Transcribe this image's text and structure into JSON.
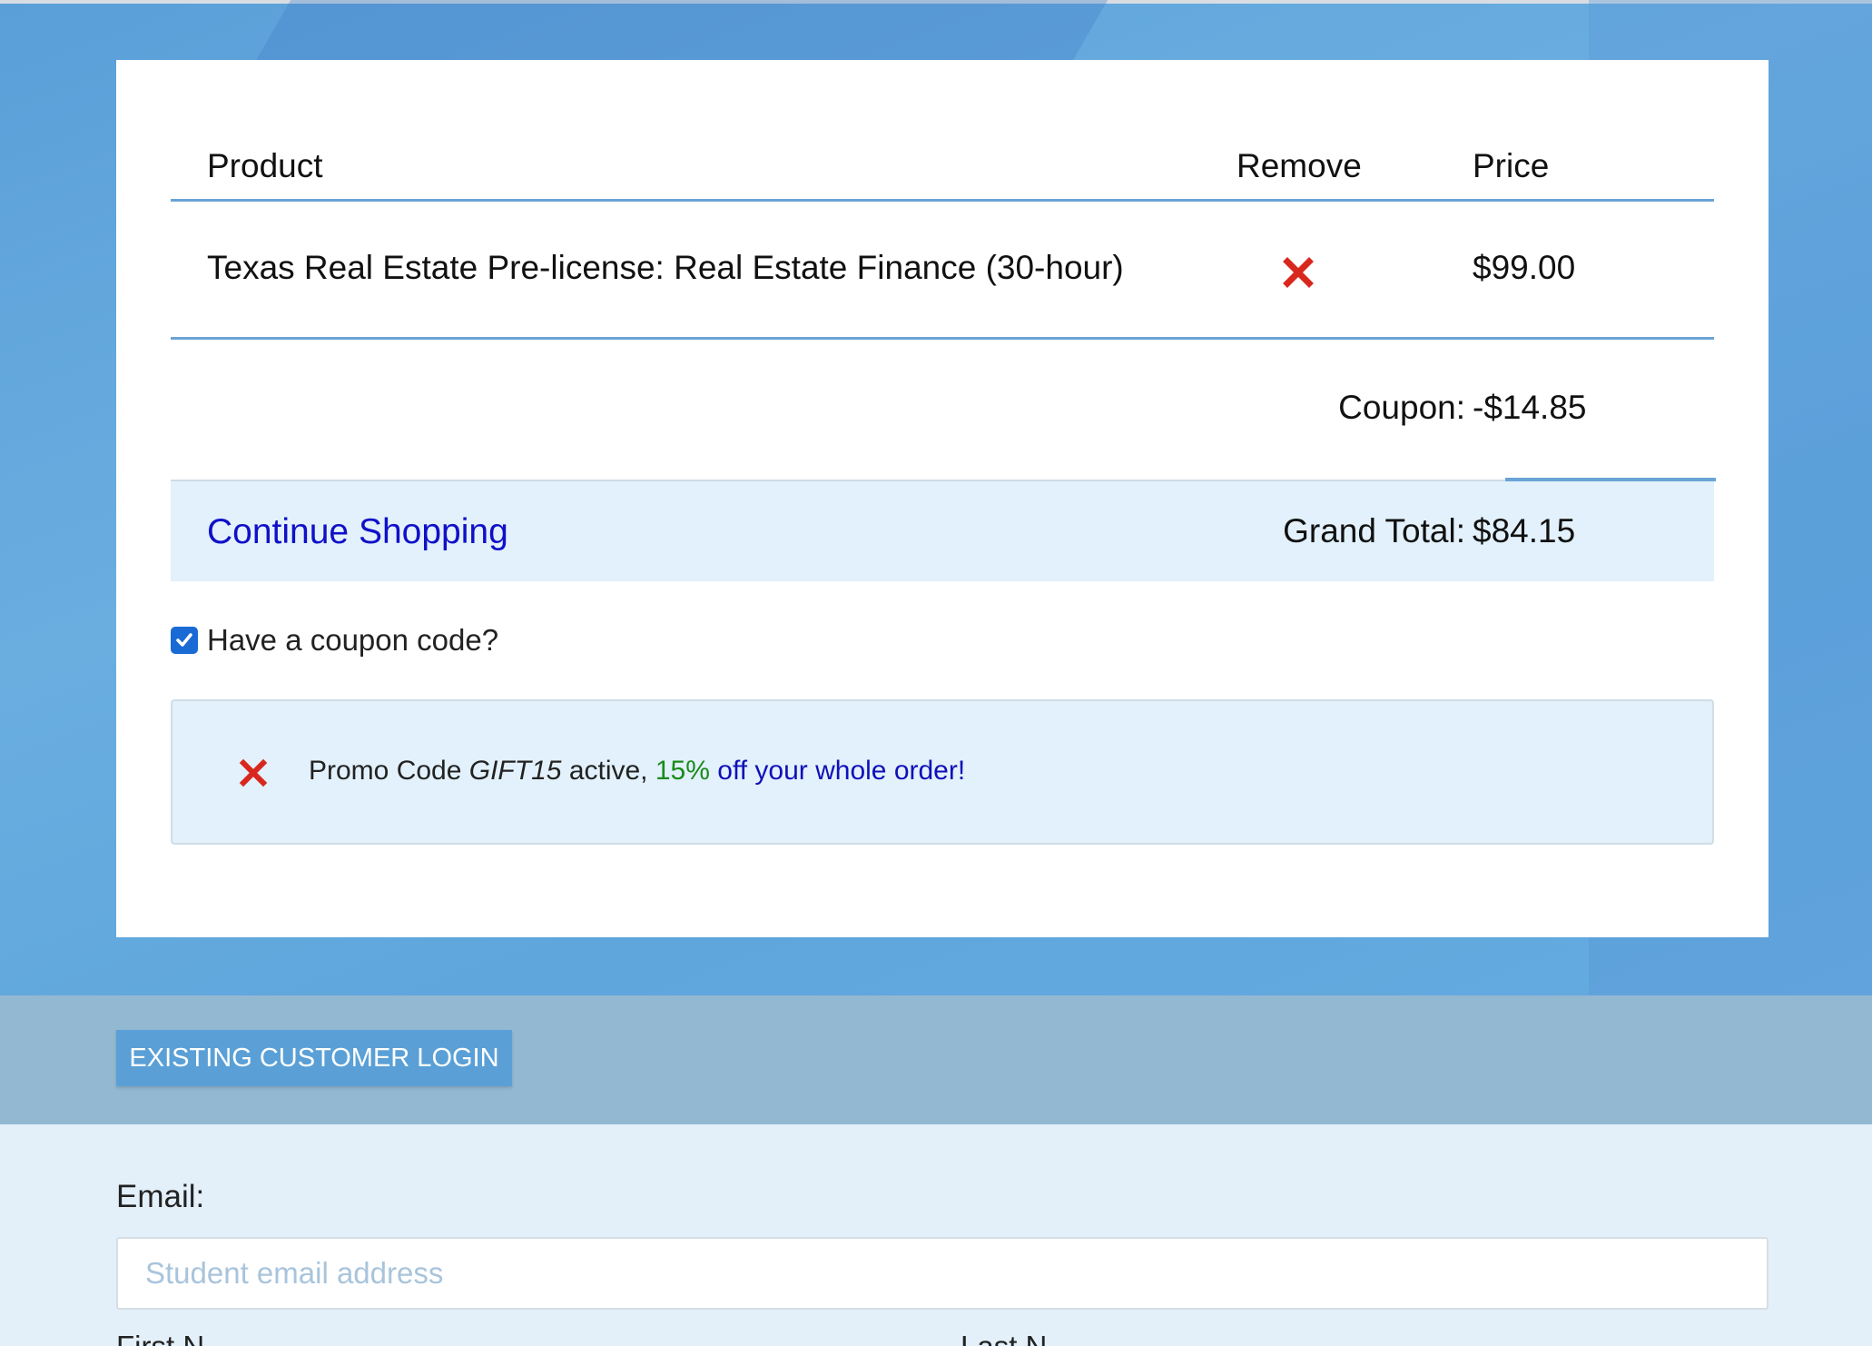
{
  "cart": {
    "headers": {
      "product": "Product",
      "remove": "Remove",
      "price": "Price"
    },
    "item": {
      "name": "Texas Real Estate Pre-license: Real Estate Finance (30-hour)",
      "remove_icon": "close-icon",
      "price": "$99.00"
    },
    "coupon": {
      "label": "Coupon:",
      "value": "-$14.85"
    },
    "total": {
      "continue_link": "Continue Shopping",
      "label": "Grand Total:",
      "value": "$84.15"
    }
  },
  "coupon_toggle": {
    "label": "Have a coupon code?",
    "checked": true
  },
  "promo": {
    "remove_icon": "close-icon",
    "prefix": "Promo Code",
    "code": "GIFT15",
    "active": "active,",
    "percent": "15%",
    "rest": "off your whole order!"
  },
  "login": {
    "button": "EXISTING CUSTOMER LOGIN"
  },
  "form": {
    "email_label": "Email:",
    "email_placeholder": "Student email address",
    "email_value": "",
    "first_name_label": "First N",
    "last_name_label": "Last N"
  },
  "colors": {
    "accent_blue": "#5aa0d6",
    "divider_blue": "#6aa3d6",
    "remove_red": "#d8281e",
    "link_blue": "#1010c8",
    "percent_green": "#1a8a1a"
  }
}
